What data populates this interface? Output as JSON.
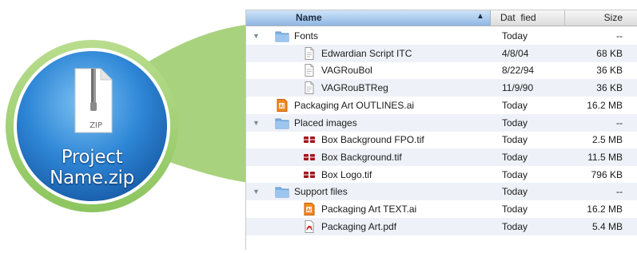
{
  "archive": {
    "icon_label": "ZIP",
    "name_line1": "Project",
    "name_line2": "Name.zip"
  },
  "columns": {
    "name": "Name",
    "date": "Dat  fied",
    "size": "Size"
  },
  "rows": [
    {
      "name": "Fonts",
      "date": "Today",
      "size": "--",
      "icon": "folder-icon",
      "expanded": true,
      "level": 0
    },
    {
      "name": "Edwardian Script ITC",
      "date": "4/8/04",
      "size": "68 KB",
      "icon": "document-icon",
      "level": 1
    },
    {
      "name": "VAGRouBol",
      "date": "8/22/94",
      "size": "36 KB",
      "icon": "document-icon",
      "level": 1
    },
    {
      "name": "VAGRouBTReg",
      "date": "11/9/90",
      "size": "36 KB",
      "icon": "document-icon",
      "level": 1
    },
    {
      "name": "Packaging Art OUTLINES.ai",
      "date": "Today",
      "size": "16.2 MB",
      "icon": "illustrator-file-icon",
      "level": 0
    },
    {
      "name": "Placed images",
      "date": "Today",
      "size": "--",
      "icon": "folder-icon",
      "expanded": true,
      "level": 0
    },
    {
      "name": "Box Background FPO.tif",
      "date": "Today",
      "size": "2.5 MB",
      "icon": "tiff-image-icon",
      "level": 1
    },
    {
      "name": "Box Background.tif",
      "date": "Today",
      "size": "11.5 MB",
      "icon": "tiff-image-icon",
      "level": 1
    },
    {
      "name": "Box Logo.tif",
      "date": "Today",
      "size": "796 KB",
      "icon": "tiff-image-icon",
      "level": 1
    },
    {
      "name": "Support files",
      "date": "Today",
      "size": "--",
      "icon": "folder-icon",
      "expanded": true,
      "level": 0
    },
    {
      "name": "Packaging Art TEXT.ai",
      "date": "Today",
      "size": "16.2 MB",
      "icon": "illustrator-file-icon",
      "level": 1
    },
    {
      "name": "Packaging Art.pdf",
      "date": "Today",
      "size": "5.4 MB",
      "icon": "pdf-file-icon",
      "level": 1
    }
  ],
  "colors": {
    "accent_green": "#9ccf6f",
    "circle_blue": "#2e86d6",
    "header_selected": "#9cbfe8",
    "alt_row": "#eef2f8"
  }
}
